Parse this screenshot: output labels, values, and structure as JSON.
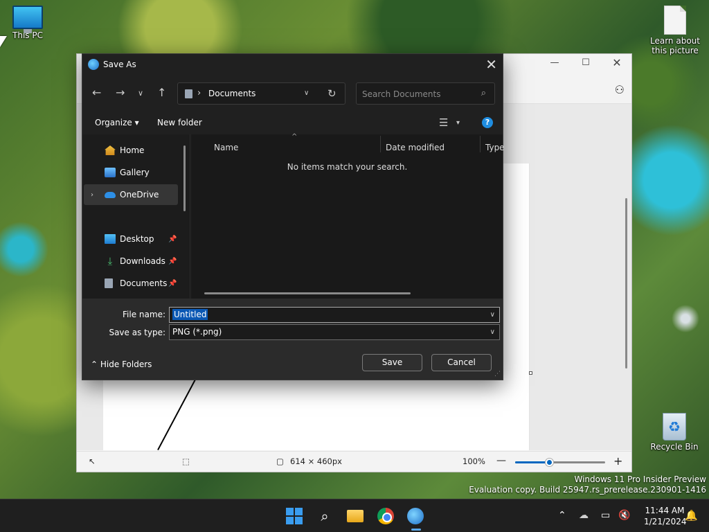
{
  "desktop": {
    "this_pc_label": "This PC",
    "learn_label": "Learn about this picture",
    "recycle_label": "Recycle Bin"
  },
  "paint": {
    "status": {
      "dimensions": "614 × 460px",
      "zoom": "100%",
      "zoom_slider_fraction": 0.38
    }
  },
  "dialog": {
    "title": "Save As",
    "address": {
      "path_segment": "Documents"
    },
    "search": {
      "placeholder": "Search Documents"
    },
    "toolbar": {
      "organize": "Organize ▾",
      "new_folder": "New folder",
      "help": "?"
    },
    "nav_items": [
      {
        "label": "Home",
        "icon": "home-icon"
      },
      {
        "label": "Gallery",
        "icon": "gallery-icon"
      },
      {
        "label": "OneDrive",
        "icon": "onedrive-icon",
        "selected": true
      },
      {
        "label": "Desktop",
        "icon": "desktop-icon",
        "pinned": true
      },
      {
        "label": "Downloads",
        "icon": "downloads-icon",
        "pinned": true
      },
      {
        "label": "Documents",
        "icon": "documents-icon",
        "pinned": true
      }
    ],
    "columns": [
      "Name",
      "Date modified",
      "Type"
    ],
    "empty_message": "No items match your search.",
    "file_name_label": "File name:",
    "file_name_value": "Untitled",
    "save_type_label": "Save as type:",
    "save_type_value": "PNG (*.png)",
    "hide_folders": "Hide Folders",
    "save_button": "Save",
    "cancel_button": "Cancel"
  },
  "watermark": {
    "line1": "Windows 11 Pro Insider Preview",
    "line2": "Evaluation copy. Build 25947.rs_prerelease.230901-1416"
  },
  "taskbar": {
    "time": "11:44 AM",
    "date": "1/21/2024"
  }
}
